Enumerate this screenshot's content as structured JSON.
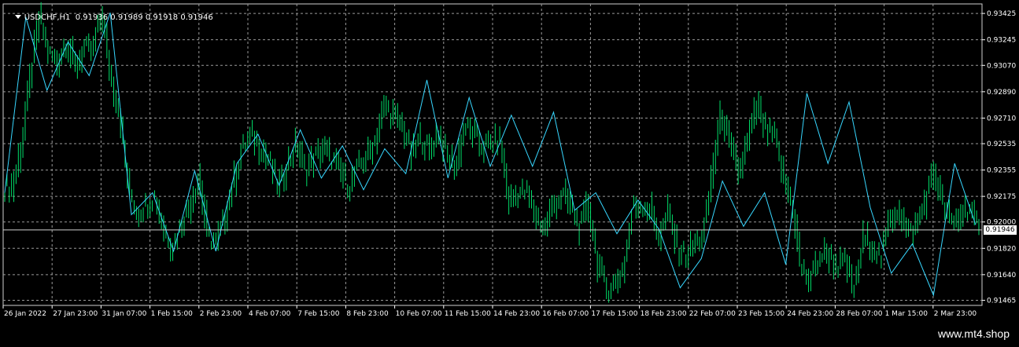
{
  "window": {
    "title": "USDCHF,H1  0.91936 0.91989 0.91918 0.91946",
    "watermark": "www.mt4.shop"
  },
  "colors": {
    "background": "#000000",
    "grid": "#9a9a9a",
    "axis_text": "#ffffff",
    "bars": "#00e06a",
    "zigzag": "#37d7ff",
    "current_price_line": "#cfcfcf"
  },
  "chart_data": {
    "type": "line",
    "symbol": "USDCHF",
    "timeframe": "H1",
    "ohlc_last": {
      "open": 0.91936,
      "high": 0.91989,
      "low": 0.91918,
      "close": 0.91946
    },
    "current_price": 0.91946,
    "current_price_label": "0.91946",
    "ylim": [
      0.9143,
      0.9349
    ],
    "y_ticks": [
      "0.93425",
      "0.93245",
      "0.93070",
      "0.92890",
      "0.92710",
      "0.92535",
      "0.92355",
      "0.92175",
      "0.92000",
      "0.91820",
      "0.91640",
      "0.91465"
    ],
    "x_ticks": [
      "26 Jan 2022",
      "27 Jan 23:00",
      "31 Jan 07:00",
      "1 Feb 15:00",
      "2 Feb 23:00",
      "4 Feb 07:00",
      "7 Feb 15:00",
      "8 Feb 23:00",
      "10 Feb 07:00",
      "11 Feb 15:00",
      "14 Feb 23:00",
      "16 Feb 07:00",
      "17 Feb 15:00",
      "18 Feb 23:00",
      "22 Feb 07:00",
      "23 Feb 15:00",
      "24 Feb 23:00",
      "28 Feb 07:00",
      "1 Mar 15:00",
      "2 Mar 23:00"
    ],
    "grid": true,
    "series": [
      {
        "values": [
          0.9223,
          0.9225,
          0.9254,
          0.9301,
          0.934,
          0.9315,
          0.9309,
          0.9324,
          0.9306,
          0.9318,
          0.9317,
          0.9343,
          0.9301,
          0.9276,
          0.9225,
          0.9206,
          0.9212,
          0.9218,
          0.9196,
          0.9183,
          0.9199,
          0.9213,
          0.9231,
          0.919,
          0.9185,
          0.9206,
          0.923,
          0.9252,
          0.9259,
          0.9251,
          0.924,
          0.9223,
          0.924,
          0.9253,
          0.9235,
          0.9244,
          0.925,
          0.9243,
          0.9234,
          0.9224,
          0.9238,
          0.9245,
          0.9258,
          0.928,
          0.9271,
          0.9266,
          0.9245,
          0.9258,
          0.9248,
          0.9262,
          0.9245,
          0.9238,
          0.9265,
          0.926,
          0.9251,
          0.9254,
          0.9256,
          0.9214,
          0.922,
          0.922,
          0.9205,
          0.9195,
          0.9212,
          0.9218,
          0.9211,
          0.9195,
          0.9213,
          0.9172,
          0.9154,
          0.9158,
          0.917,
          0.921,
          0.9212,
          0.9208,
          0.919,
          0.9207,
          0.9182,
          0.9177,
          0.9185,
          0.9192,
          0.9236,
          0.9275,
          0.925,
          0.9234,
          0.9255,
          0.9279,
          0.9262,
          0.9258,
          0.923,
          0.9212,
          0.9168,
          0.916,
          0.9176,
          0.9179,
          0.917,
          0.9172,
          0.9153,
          0.9188,
          0.9185,
          0.9175,
          0.9202,
          0.921,
          0.9192,
          0.9197,
          0.9215,
          0.9235,
          0.9212,
          0.9198,
          0.9205,
          0.9211,
          0.9193
        ]
      },
      {
        "values": [
          0.922,
          0.934,
          0.929,
          0.9323,
          0.93,
          0.9343,
          0.9205,
          0.922,
          0.918,
          0.9235,
          0.918,
          0.924,
          0.926,
          0.9225,
          0.9263,
          0.923,
          0.9252,
          0.9222,
          0.925,
          0.9233,
          0.9297,
          0.923,
          0.9285,
          0.9238,
          0.9273,
          0.9238,
          0.9275,
          0.9208,
          0.922,
          0.9192,
          0.9215,
          0.9195,
          0.9155,
          0.9175,
          0.9228,
          0.9197,
          0.922,
          0.9171,
          0.9288,
          0.924,
          0.9282,
          0.921,
          0.9165,
          0.9185,
          0.915,
          0.924,
          0.9198
        ]
      }
    ]
  }
}
